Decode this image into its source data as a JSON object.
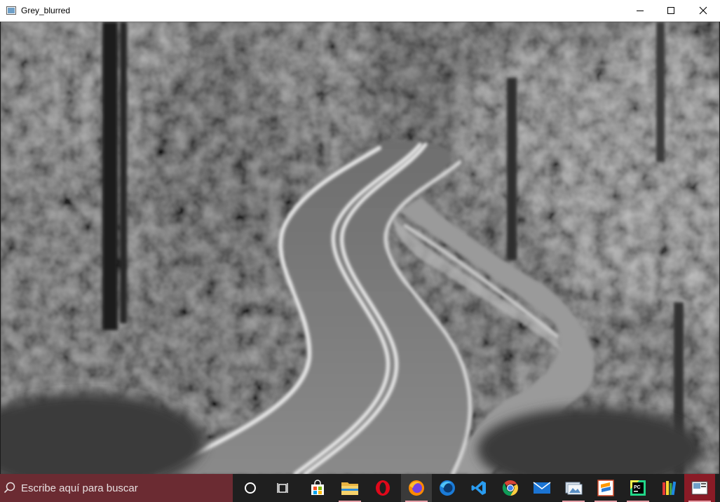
{
  "window": {
    "title": "Grey_blurred"
  },
  "titlebar_buttons": {
    "minimize": "minimize-icon",
    "maximize": "maximize-icon",
    "close": "close-icon"
  },
  "taskbar": {
    "search_placeholder": "Escribe aquí para buscar",
    "accent": "#6b2b32",
    "icons": [
      {
        "name": "cortana-icon"
      },
      {
        "name": "task-view-icon"
      },
      {
        "name": "store-icon"
      },
      {
        "name": "file-explorer-icon"
      },
      {
        "name": "opera-icon"
      },
      {
        "name": "firefox-icon"
      },
      {
        "name": "firefox-developer-icon"
      },
      {
        "name": "vscode-icon"
      },
      {
        "name": "chrome-icon"
      },
      {
        "name": "mail-icon"
      },
      {
        "name": "photos-icon"
      },
      {
        "name": "sublime-icon"
      },
      {
        "name": "pycharm-icon"
      },
      {
        "name": "books-icon"
      },
      {
        "name": "image-viewer-icon"
      }
    ]
  }
}
